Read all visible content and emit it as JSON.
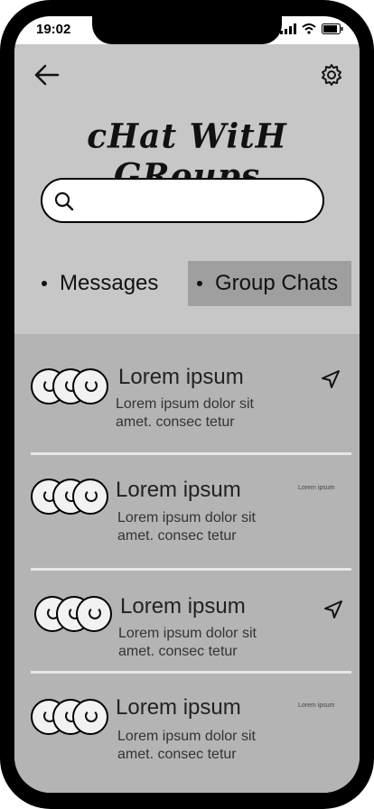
{
  "status_bar": {
    "time": "19:02"
  },
  "header": {
    "title": "cHat WitH GRoups",
    "search": {
      "placeholder": "",
      "value": ""
    }
  },
  "tabs": [
    {
      "label": "Messages",
      "selected": false
    },
    {
      "label": "Group Chats",
      "selected": true
    }
  ],
  "chats": [
    {
      "name": "Lorem ipsum",
      "snippet": "Lorem ipsum dolor sit amet. consec tetur",
      "meta": "",
      "icon": "send-icon"
    },
    {
      "name": "Lorem ipsum",
      "snippet": "Lorem ipsum dolor sit amet. consec tetur",
      "meta": "Lorem ipsum",
      "icon": ""
    },
    {
      "name": "Lorem ipsum",
      "snippet": "Lorem ipsum dolor sit amet. consec tetur",
      "meta": "",
      "icon": "send-icon"
    },
    {
      "name": "Lorem ipsum",
      "snippet": "Lorem ipsum dolor sit amet. consec tetur",
      "meta": "Lorem ipsum",
      "icon": ""
    }
  ],
  "colors": {
    "header_bg": "#c7c7c7",
    "list_bg": "#b4b4b4",
    "selected_tab_bg": "#9f9f9f",
    "divider": "#e7e7e7"
  }
}
